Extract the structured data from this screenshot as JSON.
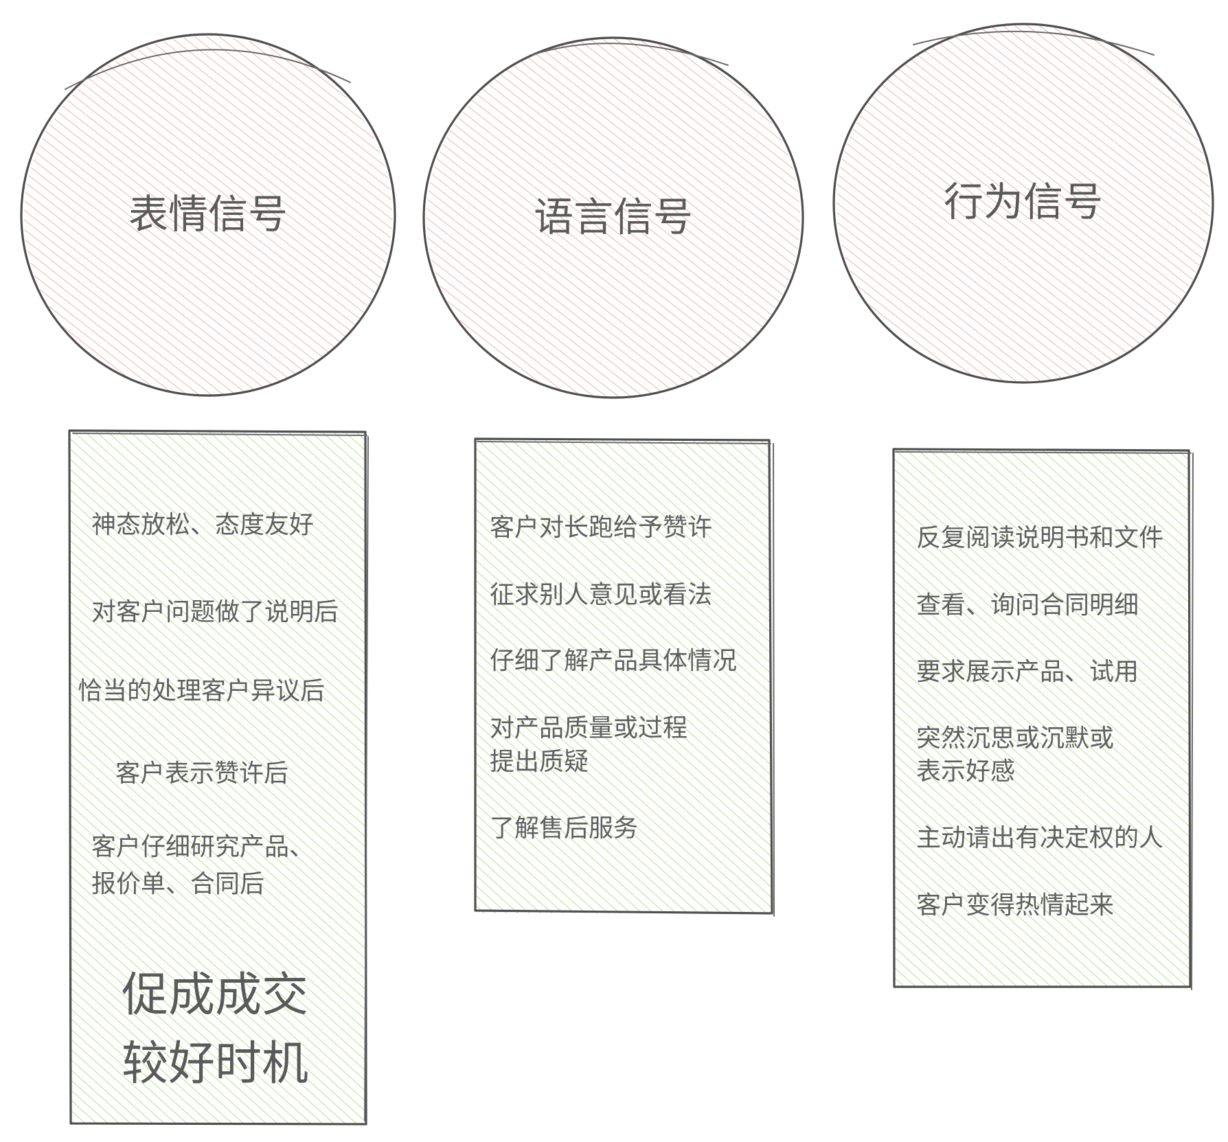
{
  "colors": {
    "circle_hatch": "#ef9a9a",
    "box_hatch": "#a9d66e",
    "outline": "#4f4f4f",
    "text": "#5f5f5f"
  },
  "signals": [
    {
      "title": "表情信号",
      "items": [
        "神态放松、态度友好",
        "对客户问题做了说明后",
        "恰当的处理客户异议后",
        "客户表示赞许后",
        "客户仔细研究产品、",
        "报价单、合同后"
      ],
      "conclusion": [
        "促成成交",
        "较好时机"
      ]
    },
    {
      "title": "语言信号",
      "items": [
        "客户对长跑给予赞许",
        "征求别人意见或看法",
        "仔细了解产品具体情况",
        "对产品质量或过程",
        "提出质疑",
        "了解售后服务"
      ]
    },
    {
      "title": "行为信号",
      "items": [
        "反复阅读说明书和文件",
        "查看、询问合同明细",
        "要求展示产品、试用",
        "突然沉思或沉默或",
        "表示好感",
        "主动请出有决定权的人",
        "客户变得热情起来"
      ]
    }
  ]
}
